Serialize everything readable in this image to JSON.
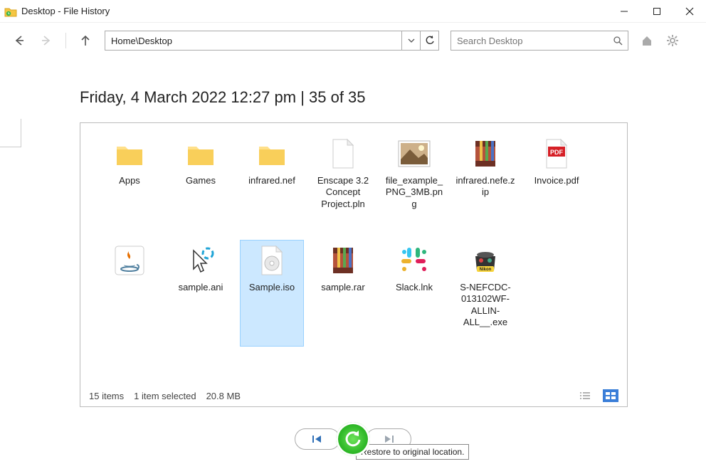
{
  "window": {
    "title": "Desktop - File History"
  },
  "toolbar": {
    "path": "Home\\Desktop",
    "search_placeholder": "Search Desktop"
  },
  "header": {
    "timestamp_line": "Friday, 4 March 2022 12:27 pm   |   35 of 35"
  },
  "files": [
    {
      "name": "Apps",
      "icon": "folder",
      "selected": false
    },
    {
      "name": "Games",
      "icon": "folder",
      "selected": false
    },
    {
      "name": "infrared.nef",
      "icon": "folder",
      "selected": false
    },
    {
      "name": "Enscape 3.2 Concept Project.pln",
      "icon": "file-blank",
      "selected": false
    },
    {
      "name": "file_example_PNG_3MB.png",
      "icon": "image",
      "selected": false
    },
    {
      "name": "infrared.nefe.zip",
      "icon": "archive",
      "selected": false
    },
    {
      "name": "Invoice.pdf",
      "icon": "pdf",
      "selected": false
    },
    {
      "name": "",
      "icon": "java",
      "selected": false
    },
    {
      "name": "sample.ani",
      "icon": "cursor",
      "selected": false
    },
    {
      "name": "Sample.iso",
      "icon": "disc",
      "selected": true
    },
    {
      "name": "sample.rar",
      "icon": "archive",
      "selected": false
    },
    {
      "name": "Slack.lnk",
      "icon": "slack",
      "selected": false
    },
    {
      "name": "S-NEFCDC-013102WF-ALLIN-ALL__.exe",
      "icon": "nikon",
      "selected": false
    }
  ],
  "status": {
    "count": "15 items",
    "selected": "1 item selected",
    "size": "20.8 MB"
  },
  "tooltip": "Restore to original location."
}
